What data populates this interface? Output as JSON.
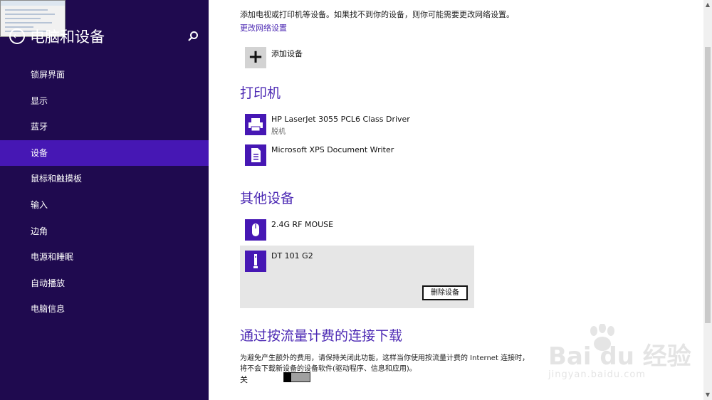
{
  "app": {
    "title": "电脑和设备"
  },
  "sidebar": {
    "items": [
      {
        "label": "锁屏界面",
        "selected": false
      },
      {
        "label": "显示",
        "selected": false
      },
      {
        "label": "蓝牙",
        "selected": false
      },
      {
        "label": "设备",
        "selected": true
      },
      {
        "label": "鼠标和触摸板",
        "selected": false
      },
      {
        "label": "输入",
        "selected": false
      },
      {
        "label": "边角",
        "selected": false
      },
      {
        "label": "电源和睡眠",
        "selected": false
      },
      {
        "label": "自动播放",
        "selected": false
      },
      {
        "label": "电脑信息",
        "selected": false
      }
    ]
  },
  "main": {
    "intro": "添加电视或打印机等设备。如果找不到你的设备，则你可能需要更改网络设置。",
    "network_link": "更改网络设置",
    "add_device_label": "添加设备",
    "printers": {
      "title": "打印机",
      "devices": [
        {
          "name": "HP LaserJet 3055 PCL6 Class Driver",
          "status": "脱机",
          "icon": "printer-icon"
        },
        {
          "name": "Microsoft XPS Document Writer",
          "status": "",
          "icon": "document-writer-icon"
        }
      ]
    },
    "other": {
      "title": "其他设备",
      "devices": [
        {
          "name": "2.4G RF MOUSE",
          "icon": "mouse-icon"
        },
        {
          "name": "DT 101 G2",
          "icon": "usb-drive-icon"
        }
      ],
      "remove_button": "删除设备"
    },
    "metered": {
      "title": "通过按流量计费的连接下载",
      "description_line1": "为避免产生额外的费用，请保持关闭此功能，这样当你使用按流量计费的 Internet 连接时，",
      "description_line2": "将不会下载新设备的设备软件(驱动程序、信息和应用)。",
      "toggle_label": "关",
      "toggle_on": false
    }
  },
  "watermark": {
    "main": "Bai du 经验",
    "sub": "jingyan.baidu.com"
  },
  "colors": {
    "sidebar_bg": "#1f0a4f",
    "selected_bg": "#4617b4",
    "accent": "#4b28b3"
  }
}
